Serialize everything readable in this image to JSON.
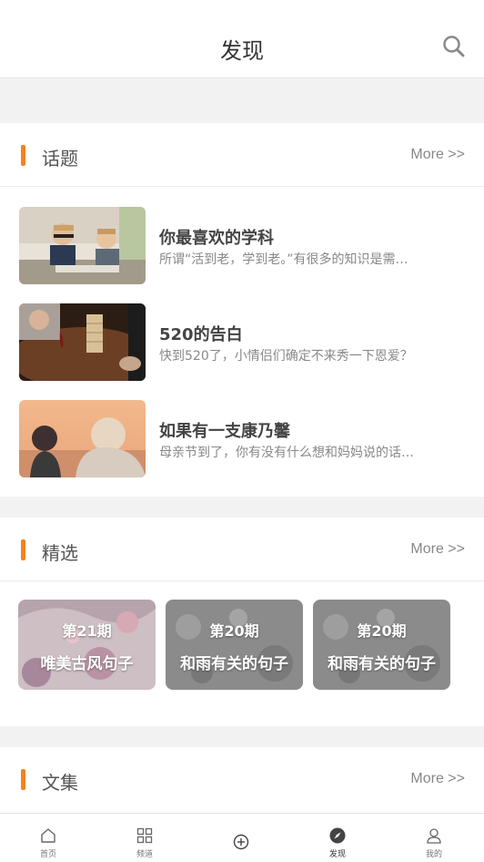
{
  "header": {
    "title": "发现",
    "search_icon": "search-icon"
  },
  "topics_section": {
    "label": "话题",
    "more": "More >>",
    "items": [
      {
        "title": "你最喜欢的学科",
        "desc": "所谓“活到老，学到老。”有很多的知识是需…"
      },
      {
        "title": "520的告白",
        "desc": "快到520了，小情侣们确定不来秀一下恩爱？"
      },
      {
        "title": "如果有一支康乃馨",
        "desc": "母亲节到了，你有没有什么想和妈妈说的话…"
      }
    ]
  },
  "featured_section": {
    "label": "精选",
    "more": "More >>",
    "cards": [
      {
        "issue": "第21期",
        "name": "唯美古风句子"
      },
      {
        "issue": "第20期",
        "name": "和雨有关的句子"
      },
      {
        "issue": "第20期",
        "name": "和雨有关的句子"
      }
    ]
  },
  "collection_section": {
    "label": "文集",
    "more": "More >>"
  },
  "tabbar": {
    "items": [
      {
        "label": "首页",
        "icon": "home-icon"
      },
      {
        "label": "频道",
        "icon": "grid-icon"
      },
      {
        "label": "",
        "icon": "add-icon"
      },
      {
        "label": "发现",
        "icon": "compass-icon"
      },
      {
        "label": "我的",
        "icon": "user-icon"
      }
    ],
    "active_index": 3
  },
  "colors": {
    "accent": "#f5821f",
    "background": "#f2f2f2"
  }
}
